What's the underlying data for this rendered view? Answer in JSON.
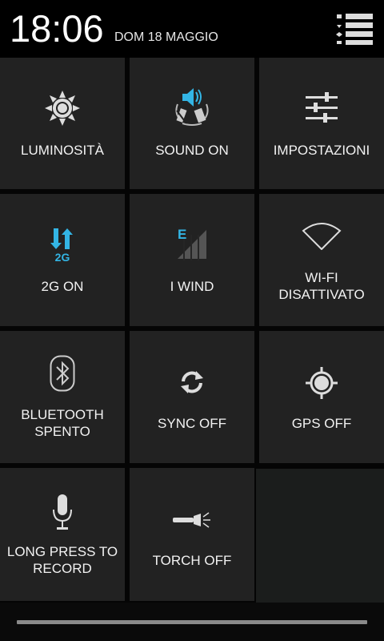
{
  "header": {
    "time": "18:06",
    "date": "DOM 18 MAGGIO"
  },
  "tiles": [
    {
      "label": "LUMINOSITÀ",
      "icon": "brightness-icon"
    },
    {
      "label": "SOUND ON",
      "icon": "sound-icon"
    },
    {
      "label": "IMPOSTAZIONI",
      "icon": "settings-sliders-icon"
    },
    {
      "label": "2G ON",
      "icon": "mobile-data-2g-icon",
      "badge": "2G"
    },
    {
      "label": "I WIND",
      "icon": "signal-icon",
      "badge": "E"
    },
    {
      "label1": "WI-FI",
      "label2": "DISATTIVATO",
      "icon": "wifi-icon"
    },
    {
      "label1": "BLUETOOTH",
      "label2": "SPENTO",
      "icon": "bluetooth-icon"
    },
    {
      "label": "SYNC OFF",
      "icon": "sync-icon"
    },
    {
      "label": "GPS OFF",
      "icon": "gps-icon"
    },
    {
      "label1": "LONG PRESS TO",
      "label2": "RECORD",
      "icon": "microphone-icon"
    },
    {
      "label": "TORCH OFF",
      "icon": "torch-icon"
    }
  ],
  "colors": {
    "accent": "#33b5e5",
    "tile": "#222222",
    "background": "#000000"
  }
}
